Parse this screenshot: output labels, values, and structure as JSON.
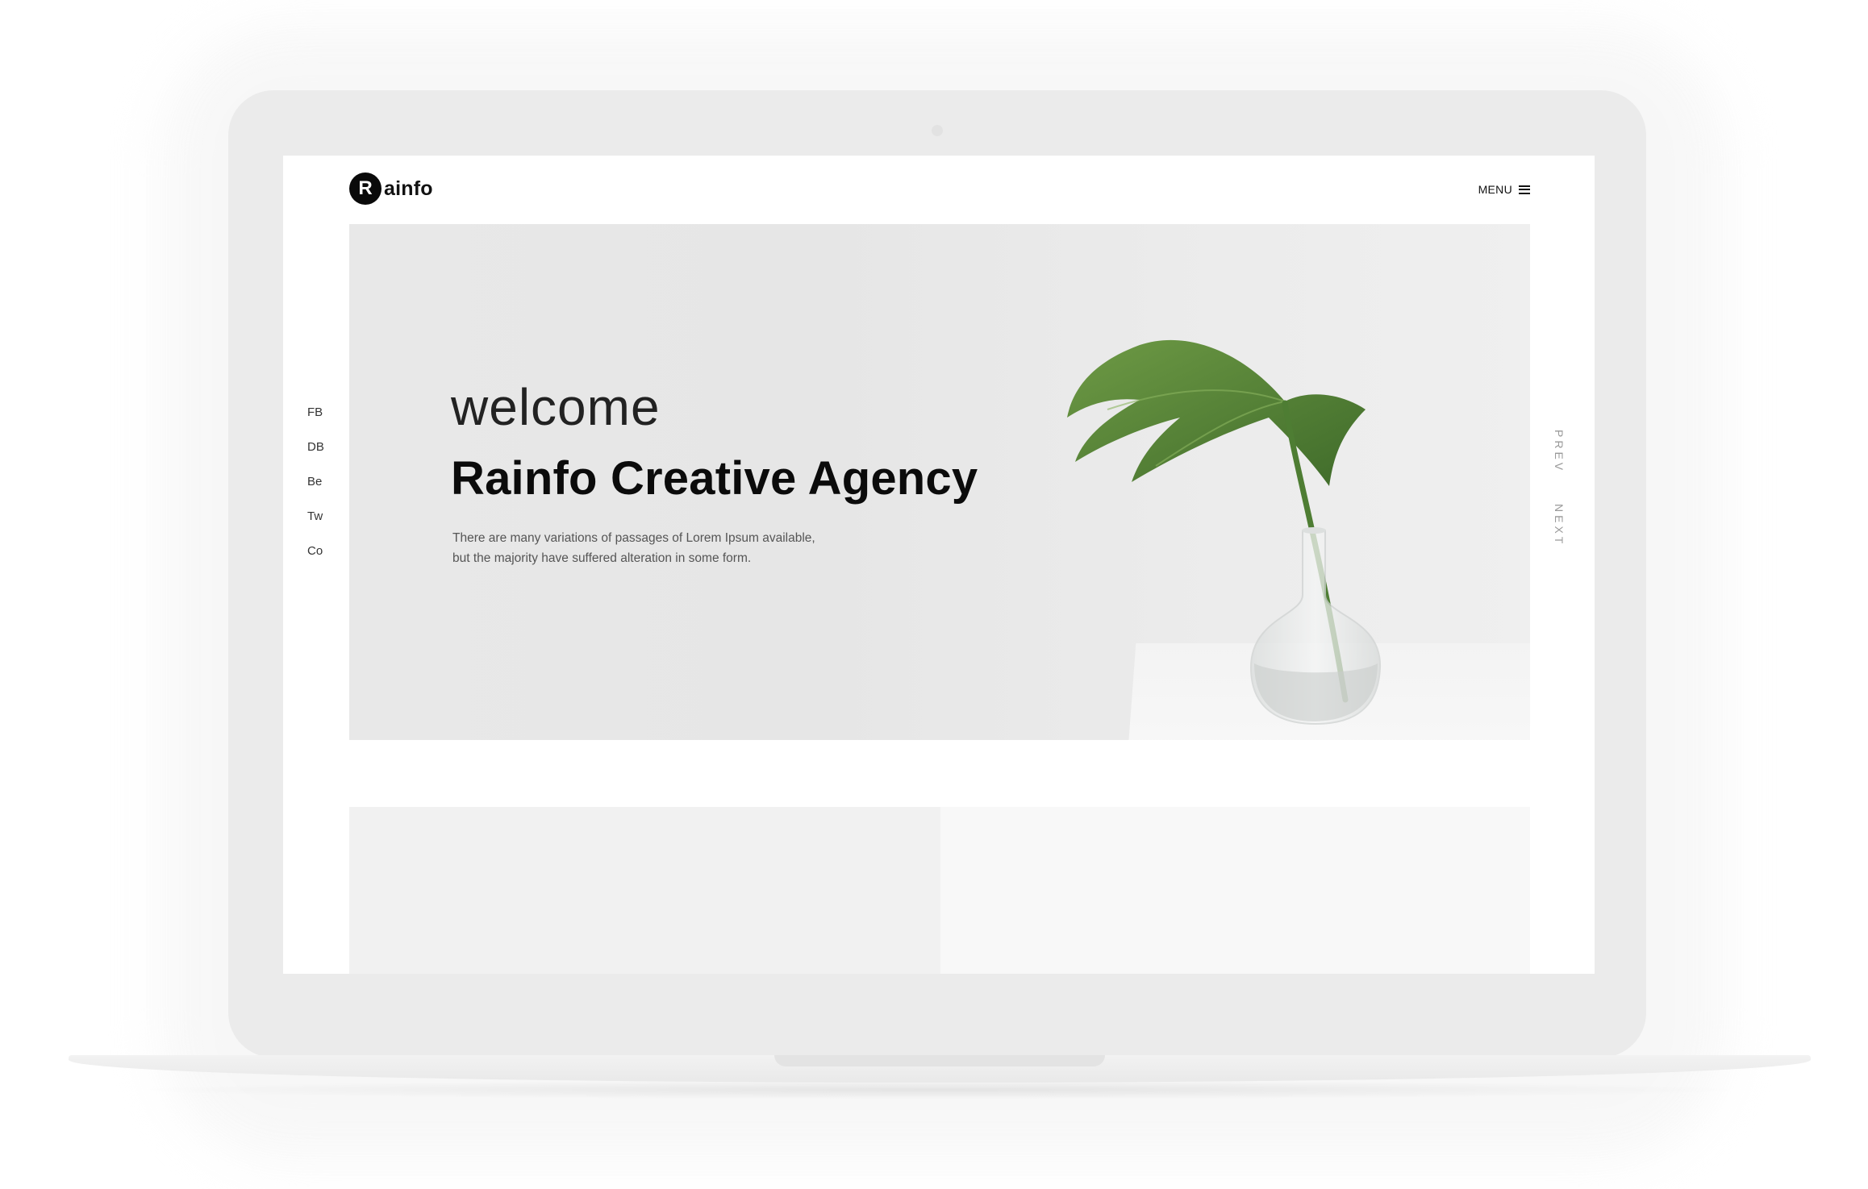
{
  "brand": {
    "logo_letter": "R",
    "logo_text": "ainfo"
  },
  "header": {
    "menu_label": "MENU",
    "menu_icon": "hamburger-icon"
  },
  "social_links": [
    "FB",
    "DB",
    "Be",
    "Tw",
    "Co"
  ],
  "hero": {
    "welcome": "welcome",
    "title": "Rainfo Creative Agency",
    "description_line1": "There are many variations of passages of Lorem Ipsum available,",
    "description_line2": "but the majority have suffered alteration in some form."
  },
  "slider": {
    "prev_label": "PREV",
    "next_label": "NEXT"
  },
  "colors": {
    "accent": "#0b0b0b",
    "hero_bg": "#e8e8e8",
    "leaf": "#5a8a3a"
  }
}
